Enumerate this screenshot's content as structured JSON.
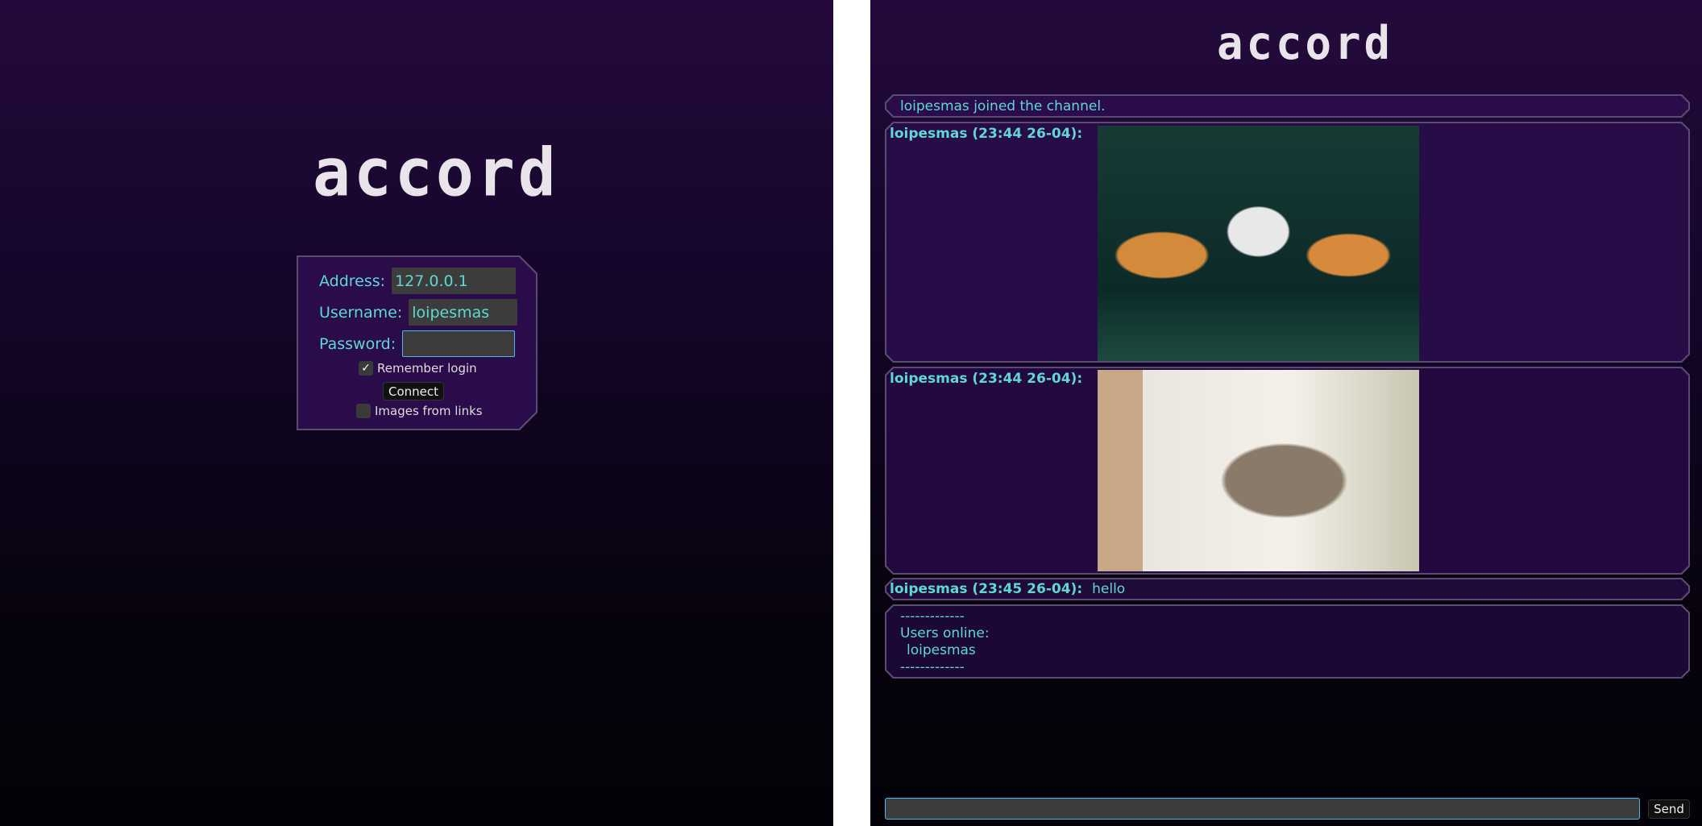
{
  "app_name": "accord",
  "login": {
    "address_label": "Address:",
    "address_value": "127.0.0.1",
    "username_label": "Username:",
    "username_value": "loipesmas",
    "password_label": "Password:",
    "password_value": "",
    "remember_label": "Remember login",
    "remember_checked": true,
    "connect_label": "Connect",
    "images_label": "Images from links",
    "images_checked": false
  },
  "chat": {
    "join_notice": "loipesmas joined the channel.",
    "messages": [
      {
        "author": "loipesmas (23:44 26-04):",
        "type": "image",
        "alt": "three cats dancing"
      },
      {
        "author": "loipesmas (23:44 26-04):",
        "type": "image",
        "alt": "cat raising paw"
      },
      {
        "author": "loipesmas (23:45 26-04):",
        "text": "hello"
      }
    ],
    "users_box": {
      "sep": "-------------",
      "title": "Users online:",
      "users": [
        "loipesmas"
      ]
    },
    "input_value": "",
    "send_label": "Send"
  }
}
